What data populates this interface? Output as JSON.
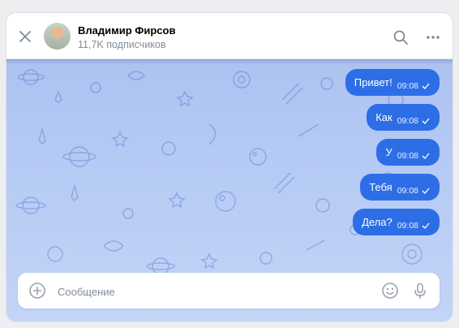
{
  "header": {
    "title": "Владимир Фирсов",
    "subtitle": "11,7K подписчиков"
  },
  "icons": {
    "close": "close-icon",
    "search": "search-icon",
    "more": "more-icon",
    "attach": "add-circle-icon",
    "emoji": "emoji-icon",
    "voice": "microphone-icon"
  },
  "messages": [
    {
      "text": "Привет!",
      "time": "09:08"
    },
    {
      "text": "Как",
      "time": "09:08"
    },
    {
      "text": "У",
      "time": "09:08"
    },
    {
      "text": "Тебя",
      "time": "09:08"
    },
    {
      "text": "Дела?",
      "time": "09:08"
    }
  ],
  "composer": {
    "placeholder": "Сообщение",
    "value": ""
  },
  "colors": {
    "bubble": "#2d6ee6",
    "chat_background": "#b6cbf4"
  }
}
